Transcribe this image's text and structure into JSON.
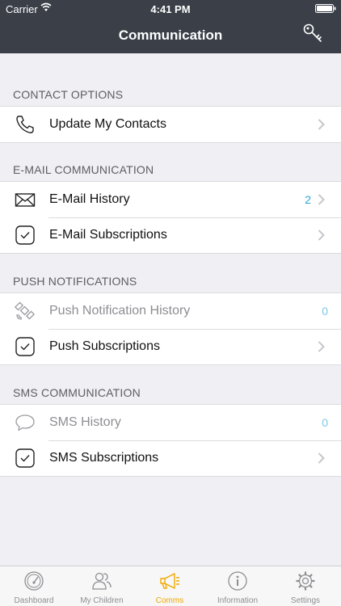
{
  "status_bar": {
    "carrier": "Carrier",
    "time": "4:41 PM"
  },
  "nav": {
    "title": "Communication",
    "right_icon": "key-icon"
  },
  "sections": [
    {
      "header": "CONTACT OPTIONS",
      "rows": [
        {
          "label": "Update My Contacts",
          "icon": "phone-icon",
          "count": "",
          "chevron": true,
          "enabled": true
        }
      ]
    },
    {
      "header": "E-MAIL COMMUNICATION",
      "rows": [
        {
          "label": "E-Mail History",
          "icon": "envelope-icon",
          "count": "2",
          "chevron": true,
          "enabled": true
        },
        {
          "label": "E-Mail Subscriptions",
          "icon": "checkbox-icon",
          "count": "",
          "chevron": true,
          "enabled": true
        }
      ]
    },
    {
      "header": "PUSH NOTIFICATIONS",
      "rows": [
        {
          "label": "Push Notification History",
          "icon": "satellite-icon",
          "count": "0",
          "chevron": false,
          "enabled": false
        },
        {
          "label": "Push Subscriptions",
          "icon": "checkbox-icon",
          "count": "",
          "chevron": true,
          "enabled": true
        }
      ]
    },
    {
      "header": "SMS COMMUNICATION",
      "rows": [
        {
          "label": "SMS History",
          "icon": "speech-bubble-icon",
          "count": "0",
          "chevron": false,
          "enabled": false
        },
        {
          "label": "SMS Subscriptions",
          "icon": "checkbox-icon",
          "count": "",
          "chevron": true,
          "enabled": true
        }
      ]
    }
  ],
  "tabbar": {
    "active": "Comms",
    "tabs": [
      {
        "label": "Dashboard",
        "icon": "speedometer-icon"
      },
      {
        "label": "My Children",
        "icon": "people-icon"
      },
      {
        "label": "Comms",
        "icon": "megaphone-icon"
      },
      {
        "label": "Information",
        "icon": "info-icon"
      },
      {
        "label": "Settings",
        "icon": "gear-icon"
      }
    ]
  },
  "colors": {
    "nav_background": "#3a3f48",
    "accent_count": "#2aa6d6",
    "active_tab": "#f0a800",
    "background": "#efeff4"
  }
}
